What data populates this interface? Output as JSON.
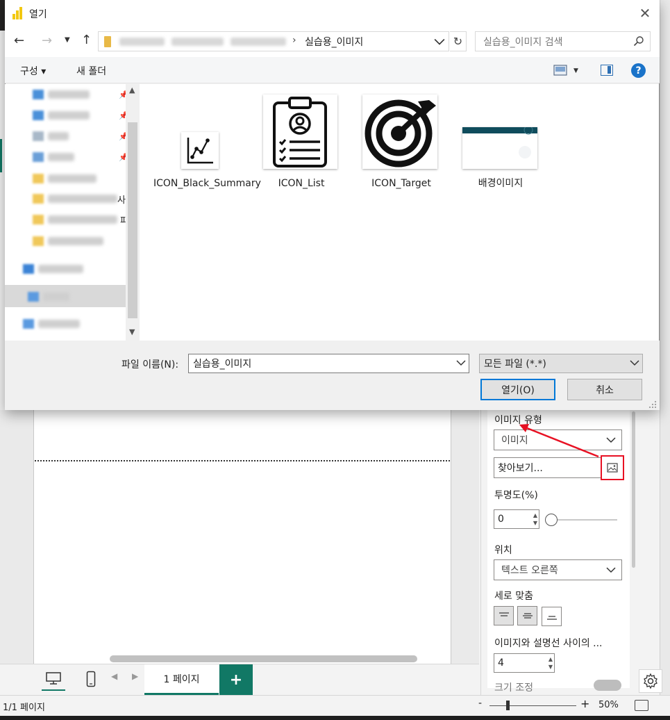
{
  "dialog": {
    "title": "열기",
    "breadcrumb_current": "실습용_이미지",
    "breadcrumb_separator": "›",
    "search_placeholder": "실습용_이미지 검색",
    "organize_label": "구성 ▾",
    "new_folder_label": "새 폴더",
    "help_label": "?",
    "tree_trailing_texts": [
      "사",
      "파"
    ],
    "files": [
      {
        "name": "ICON_Black_Summary",
        "icon": "line-chart-icon"
      },
      {
        "name": "ICON_List",
        "icon": "clipboard-profile-icon"
      },
      {
        "name": "ICON_Target",
        "icon": "target-icon"
      },
      {
        "name": "배경이미지",
        "icon": "background-image-thumbnail"
      }
    ],
    "filename_label": "파일 이름(N):",
    "filename_value": "실습용_이미지",
    "filetype_value": "모든 파일 (*.*)",
    "open_button": "열기(O)",
    "cancel_button": "취소"
  },
  "format_pane": {
    "image_type_label": "이미지 유형",
    "image_type_value": "이미지",
    "browse_value": "찾아보기...",
    "transparency_label": "투명도(%)",
    "transparency_value": "0",
    "transparency_level": 0,
    "position_label": "위치",
    "position_value": "텍스트 오른쪽",
    "vertical_align_label": "세로 맞춤",
    "spacing_label": "이미지와 설명선 사이의 ...",
    "spacing_value": "4",
    "size_label": "크기 조정"
  },
  "report": {
    "page_tab_label": "1 페이지",
    "add_page_label": "+",
    "status_page": "1/1 페이지",
    "zoom_minus": "-",
    "zoom_plus": "+",
    "zoom_value": "50%"
  },
  "colors": {
    "accent_green": "#117865",
    "highlight_red": "#e81123",
    "help_blue": "#1a73c9"
  }
}
